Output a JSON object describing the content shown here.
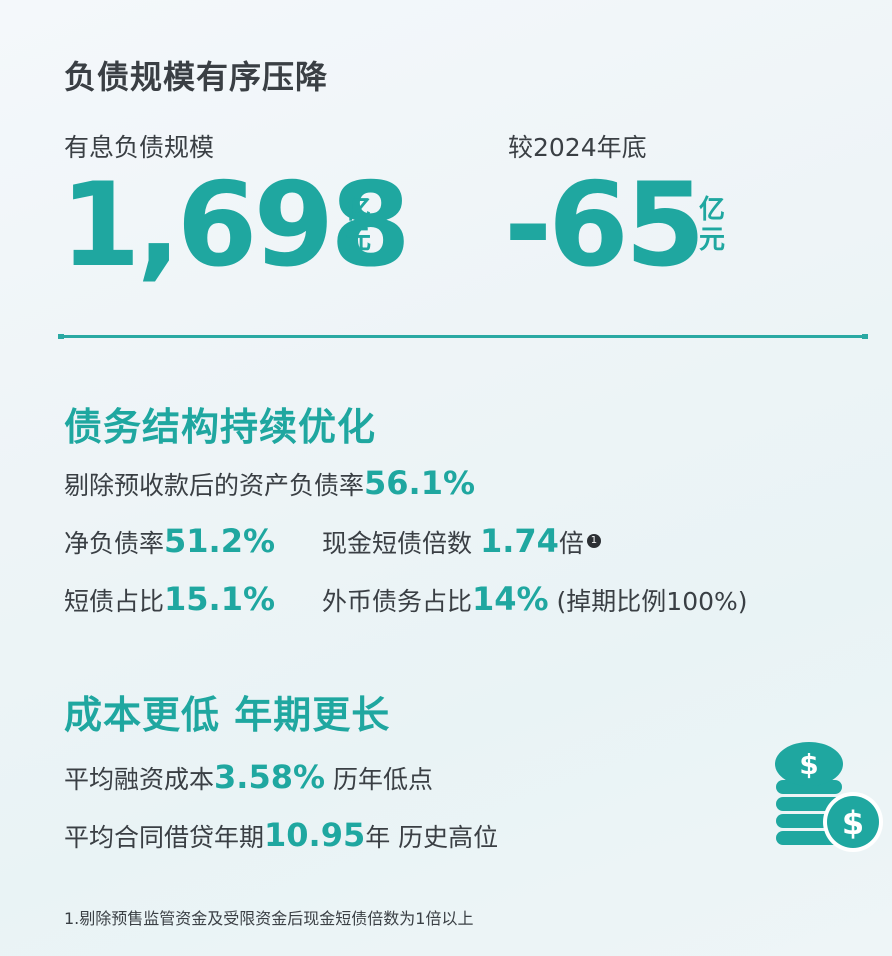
{
  "section1": {
    "title": "负债规模有序压降",
    "stat_left": {
      "label": "有息负债规模",
      "value": "1,698",
      "unit_top": "亿",
      "unit_bottom": "元"
    },
    "stat_right": {
      "label": "较2024年底",
      "value": "-65",
      "unit_top": "亿",
      "unit_bottom": "元"
    }
  },
  "section2": {
    "title": "债务结构持续优化",
    "row1": {
      "label": "剔除预收款后的资产负债率",
      "value": "56.1%"
    },
    "row2a": {
      "label": "净负债率",
      "value": "51.2%"
    },
    "row2b": {
      "label": "现金短债倍数 ",
      "value": "1.74",
      "suffix": "倍",
      "footnote_mark": "1"
    },
    "row3a": {
      "label": "短债占比",
      "value": "15.1%"
    },
    "row3b": {
      "label": "外币债务占比",
      "value": "14%",
      "suffix": " (掉期比例100%)"
    }
  },
  "section3": {
    "title": "成本更低 年期更长",
    "row1": {
      "label": "平均融资成本",
      "value": "3.58%",
      "suffix": " 历年低点"
    },
    "row2": {
      "label": "平均合同借贷年期",
      "value": "10.95",
      "suffix": "年 历史高位"
    }
  },
  "footnote": "1.剔除预售监管资金及受限资金后现金短债倍数为1倍以上",
  "icons": {
    "coins": "dollar-coins-icon"
  },
  "colors": {
    "accent": "#1fa7a0",
    "text": "#3a3f44"
  }
}
